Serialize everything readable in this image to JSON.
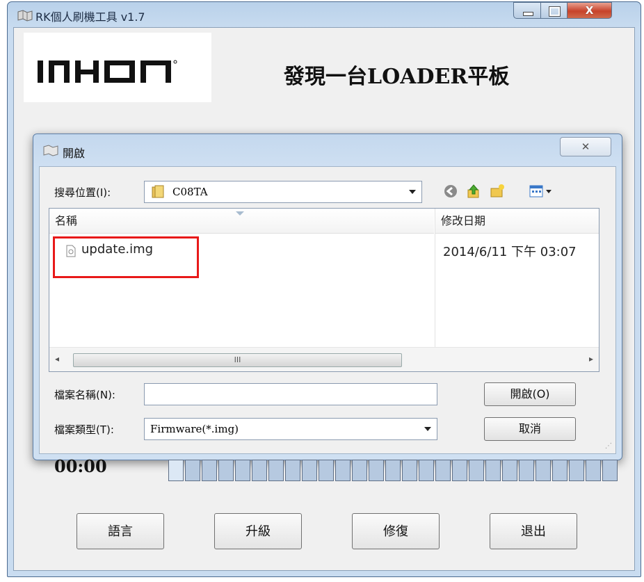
{
  "window": {
    "title": "RK個人刷機工具 v1.7",
    "close_label": "X",
    "status_text": "發現一台LOADER平板",
    "logo_text": "INHON",
    "timer": "00:00",
    "progress_segments": 27,
    "progress_filled_fraction": 0.04,
    "buttons": [
      "語言",
      "升級",
      "修復",
      "退出"
    ]
  },
  "dialog": {
    "title": "開啟",
    "close_label": "✕",
    "look_in_label": "搜尋位置(I):",
    "look_in_value": "C08TA",
    "columns": {
      "name": "名稱",
      "date": "修改日期"
    },
    "files": [
      {
        "name": "update.img",
        "date": "2014/6/11 下午 03:07"
      }
    ],
    "scroll_thumb": "III",
    "filename_label": "檔案名稱(N):",
    "filename_value": "",
    "filetype_label": "檔案類型(T):",
    "filetype_value": "Firmware(*.img)",
    "open_button": "開啟(O)",
    "cancel_button": "取消",
    "toolbar_icons": [
      "back-icon",
      "up-folder-icon",
      "new-folder-icon",
      "view-menu-icon"
    ]
  },
  "colors": {
    "highlight": "#e81919",
    "window_frame": "#c9dcf0"
  }
}
